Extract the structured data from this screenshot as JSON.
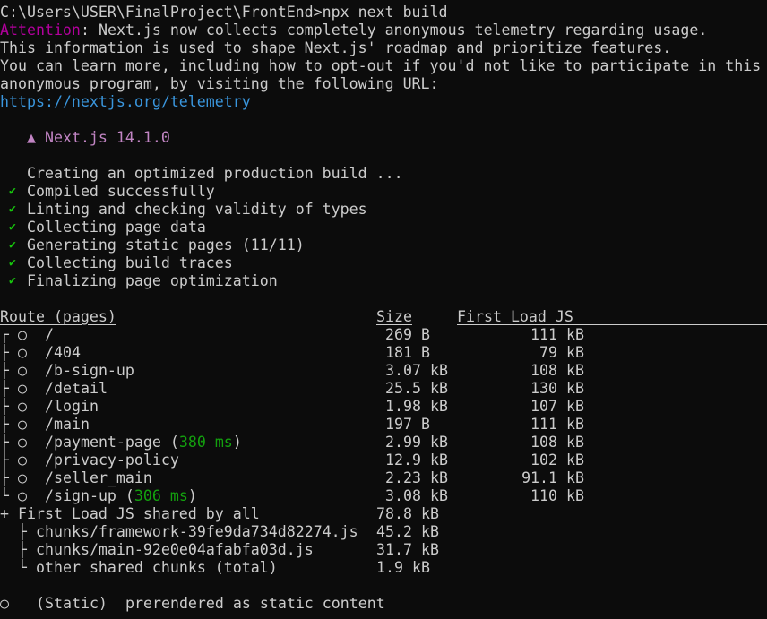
{
  "prompt": "C:\\Users\\USER\\FinalProject\\FrontEnd>npx next build",
  "telemetry": {
    "attention_label": "Attention",
    "line1_rest": ": Next.js now collects completely anonymous telemetry regarding usage.",
    "line2": "This information is used to shape Next.js' roadmap and prioritize features.",
    "line3": "You can learn more, including how to opt-out if you'd not like to participate in this",
    "line4": "anonymous program, by visiting the following URL:",
    "url": "https://nextjs.org/telemetry"
  },
  "version_line": "▲ Next.js 14.1.0",
  "build_steps": {
    "creating": "Creating an optimized production build ...",
    "steps": [
      "Compiled successfully",
      "Linting and checking validity of types",
      "Collecting page data",
      "Generating static pages (11/11)",
      "Collecting build traces",
      "Finalizing page optimization"
    ]
  },
  "table": {
    "headers": {
      "route": "Route (pages)",
      "size": "Size",
      "first_load": "First Load JS"
    },
    "rows": [
      {
        "prefix": "┌ ○ ",
        "route": "/",
        "time": "",
        "size": "269 B",
        "first_load": "111 kB"
      },
      {
        "prefix": "├ ○ ",
        "route": "/404",
        "time": "",
        "size": "181 B",
        "first_load": "79 kB"
      },
      {
        "prefix": "├ ○ ",
        "route": "/b-sign-up",
        "time": "",
        "size": "3.07 kB",
        "first_load": "108 kB"
      },
      {
        "prefix": "├ ○ ",
        "route": "/detail",
        "time": "",
        "size": "25.5 kB",
        "first_load": "130 kB"
      },
      {
        "prefix": "├ ○ ",
        "route": "/login",
        "time": "",
        "size": "1.98 kB",
        "first_load": "107 kB"
      },
      {
        "prefix": "├ ○ ",
        "route": "/main",
        "time": "",
        "size": "197 B",
        "first_load": "111 kB"
      },
      {
        "prefix": "├ ○ ",
        "route": "/payment-page",
        "time": "380 ms",
        "size": "2.99 kB",
        "first_load": "108 kB"
      },
      {
        "prefix": "├ ○ ",
        "route": "/privacy-policy",
        "time": "",
        "size": "12.9 kB",
        "first_load": "102 kB"
      },
      {
        "prefix": "├ ○ ",
        "route": "/seller_main",
        "time": "",
        "size": "2.23 kB",
        "first_load": "91.1 kB"
      },
      {
        "prefix": "└ ○ ",
        "route": "/sign-up",
        "time": "306 ms",
        "size": "3.08 kB",
        "first_load": "110 kB"
      }
    ],
    "shared": {
      "label": "+ First Load JS shared by all",
      "size": "78.8 kB",
      "chunks": [
        {
          "prefix": "  ├ ",
          "name": "chunks/framework-39fe9da734d82274.js",
          "size": "45.2 kB"
        },
        {
          "prefix": "  ├ ",
          "name": "chunks/main-92e0e04afabfa03d.js",
          "size": "31.7 kB"
        },
        {
          "prefix": "  └ ",
          "name": "other shared chunks (total)",
          "size": "1.9 kB"
        }
      ]
    }
  },
  "legend": {
    "symbol": "○",
    "label": "(Static)",
    "description": "prerendered as static content"
  },
  "colors": {
    "background": "#0c0c0c",
    "foreground": "#cccccc",
    "attention": "#b4009e",
    "link": "#3a96dd",
    "timing": "#13a10e",
    "check": "#16c60c",
    "nextjs": "#c285c4"
  }
}
